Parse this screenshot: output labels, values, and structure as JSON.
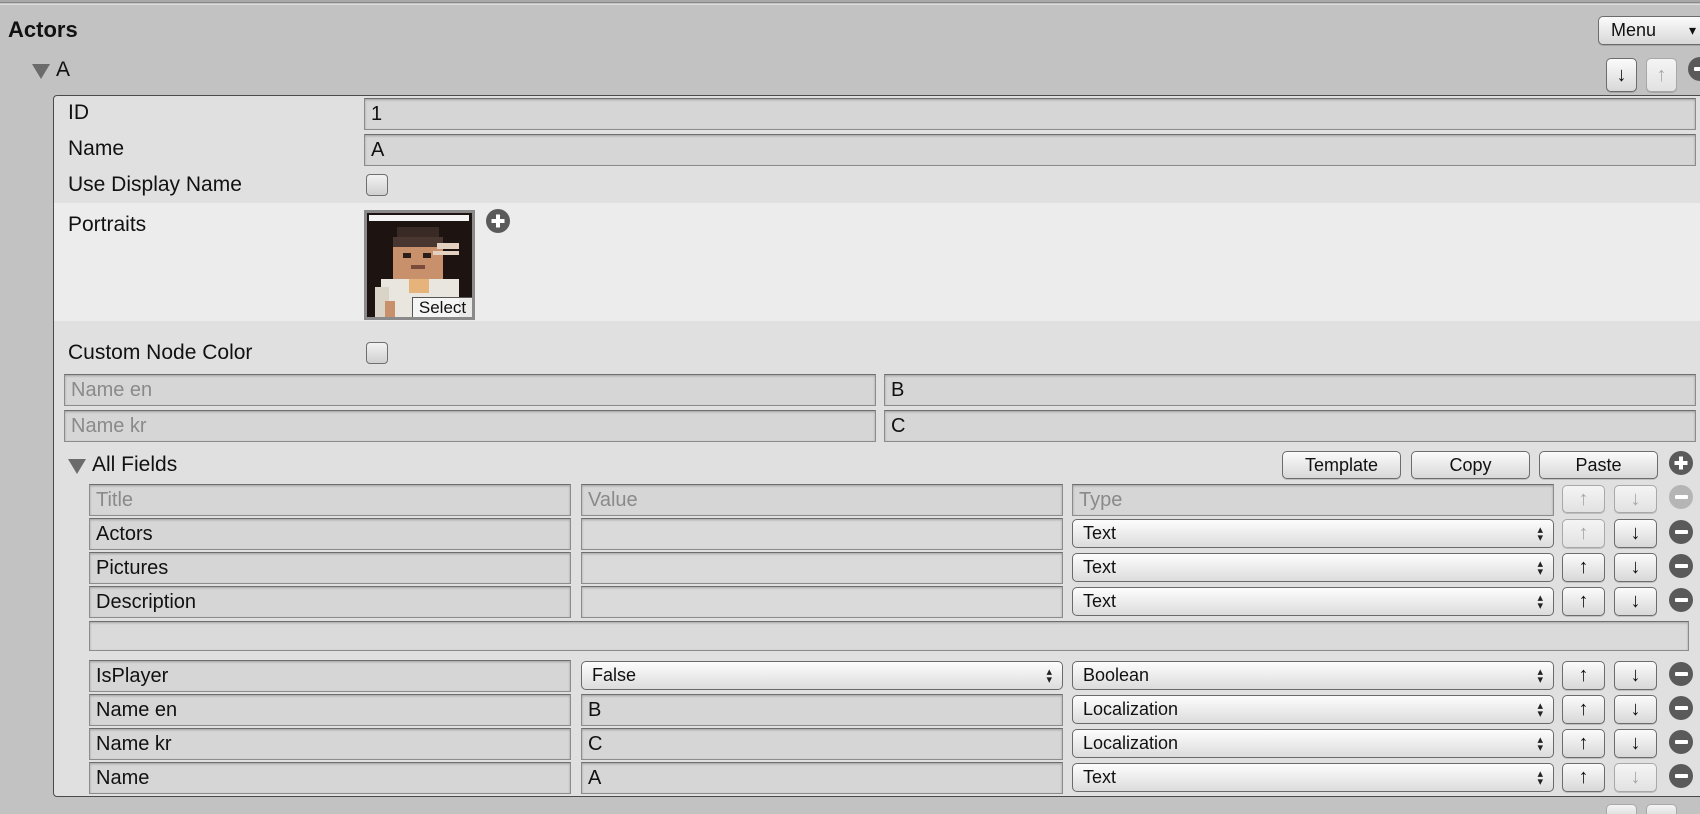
{
  "header": {
    "title": "Actors",
    "menu_label": "Menu",
    "menu_arrow": "▾"
  },
  "actor": {
    "name": "A",
    "move_down_label": "↓",
    "move_up_label": "↑",
    "id_label": "ID",
    "id_value": "1",
    "name_label": "Name",
    "name_value": "A",
    "use_display_name_label": "Use Display Name",
    "portraits_label": "Portraits",
    "portrait_select_label": "Select",
    "custom_node_color_label": "Custom Node Color",
    "localized_names": [
      {
        "label": "Name en",
        "value": "B"
      },
      {
        "label": "Name kr",
        "value": "C"
      }
    ]
  },
  "all_fields": {
    "label": "All Fields",
    "template_label": "Template",
    "copy_label": "Copy",
    "paste_label": "Paste",
    "headers": {
      "title": "Title",
      "value": "Value",
      "type": "Type"
    },
    "rows": [
      {
        "title": "Actors",
        "value": "",
        "type": "Text"
      },
      {
        "title": "Pictures",
        "value": "",
        "type": "Text"
      },
      {
        "title": "Description",
        "value": "",
        "type": "Text"
      },
      {
        "title": "IsPlayer",
        "value": "False",
        "type": "Boolean"
      },
      {
        "title": "Name en",
        "value": "B",
        "type": "Localization"
      },
      {
        "title": "Name kr",
        "value": "C",
        "type": "Localization"
      },
      {
        "title": "Name",
        "value": "A",
        "type": "Text"
      }
    ],
    "up_label": "↑",
    "down_label": "↓"
  },
  "icons": {
    "expand": "triangle-down",
    "add": "plus-circle",
    "remove": "minus-circle",
    "select_arrows": "up-down-arrows"
  }
}
